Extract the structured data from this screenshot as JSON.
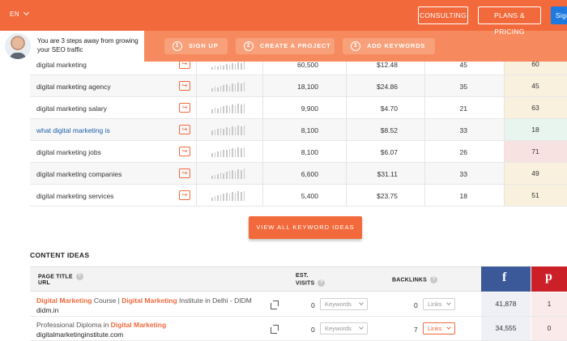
{
  "header": {
    "language": "EN",
    "consulting": "CONSULTING",
    "plans": "PLANS & PRICING",
    "sign": "Sign",
    "brand_color": "#f26a3c"
  },
  "onboarding": {
    "message": "You are 3 steps away from growing your SEO traffic",
    "steps": [
      {
        "num": "1",
        "label": "SIGN UP"
      },
      {
        "num": "2",
        "label": "CREATE A PROJECT"
      },
      {
        "num": "3",
        "label": "ADD KEYWORDS"
      }
    ]
  },
  "keywords": [
    {
      "keyword": "digital marketing",
      "volume": "60,500",
      "cpc": "$12.48",
      "pd": "45",
      "sd": "60",
      "sd_color": "#faf0de",
      "spark": [
        3,
        5,
        4,
        6,
        5,
        7,
        6,
        8,
        7,
        9,
        8,
        10
      ]
    },
    {
      "keyword": "digital marketing agency",
      "volume": "18,100",
      "cpc": "$24.86",
      "pd": "35",
      "sd": "45",
      "sd_color": "#faf0de",
      "spark": [
        4,
        6,
        5,
        7,
        8,
        9,
        7,
        10,
        9,
        11,
        10,
        12
      ]
    },
    {
      "keyword": "digital marketing salary",
      "volume": "9,900",
      "cpc": "$4.70",
      "pd": "21",
      "sd": "63",
      "sd_color": "#faf0de",
      "spark": [
        5,
        7,
        6,
        8,
        9,
        10,
        9,
        11,
        10,
        12,
        11,
        12
      ]
    },
    {
      "keyword": "what digital marketing is",
      "volume": "8,100",
      "cpc": "$8.52",
      "pd": "33",
      "sd": "18",
      "sd_color": "#e7f5ee",
      "link": true,
      "spark": [
        6,
        7,
        8,
        9,
        8,
        10,
        9,
        11,
        10,
        12,
        11,
        12
      ]
    },
    {
      "keyword": "digital marketing jobs",
      "volume": "8,100",
      "cpc": "$6.07",
      "pd": "26",
      "sd": "71",
      "sd_color": "#f8e1e1",
      "spark": [
        5,
        6,
        7,
        8,
        9,
        9,
        10,
        11,
        10,
        12,
        11,
        12
      ]
    },
    {
      "keyword": "digital marketing companies",
      "volume": "6,600",
      "cpc": "$31.11",
      "pd": "33",
      "sd": "49",
      "sd_color": "#faf0de",
      "spark": [
        4,
        5,
        6,
        8,
        7,
        9,
        10,
        11,
        9,
        12,
        11,
        13
      ]
    },
    {
      "keyword": "digital marketing services",
      "volume": "5,400",
      "cpc": "$23.75",
      "pd": "18",
      "sd": "51",
      "sd_color": "#faf0de",
      "spark": [
        4,
        6,
        7,
        8,
        9,
        10,
        9,
        11,
        10,
        12,
        11,
        12
      ]
    }
  ],
  "view_all": "VIEW ALL KEYWORD IDEAS",
  "content_ideas": {
    "title": "CONTENT IDEAS",
    "headers": {
      "page_title": "PAGE TITLE",
      "url": "URL",
      "est": "EST.",
      "visits": "VISITS",
      "backlinks": "BACKLINKS",
      "facebook_glyph": "f",
      "pinterest_glyph": "p"
    },
    "rows": [
      {
        "title_parts": [
          [
            "b",
            "Digital Marketing"
          ],
          [
            "t",
            " Course | "
          ],
          [
            "b",
            "Digital Marketing"
          ],
          [
            "t",
            " Institute in Delhi - DIDM"
          ]
        ],
        "url": "didm.in",
        "visits": "0",
        "visits_dd": "Keywords",
        "backlinks": "0",
        "links_dd": "Links",
        "links_active": false,
        "facebook": "41,878",
        "pinterest": "1"
      },
      {
        "title_parts": [
          [
            "t",
            "Professional Diploma in "
          ],
          [
            "b",
            "Digital Marketing"
          ]
        ],
        "url": "digitalmarketinginstitute.com",
        "visits": "0",
        "visits_dd": "Keywords",
        "backlinks": "7",
        "links_dd": "Links",
        "links_active": true,
        "facebook": "34,555",
        "pinterest": "0"
      }
    ]
  }
}
